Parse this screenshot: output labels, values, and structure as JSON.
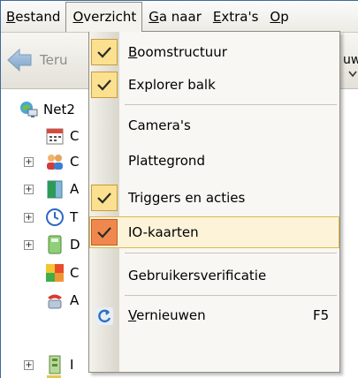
{
  "menubar": {
    "items": [
      {
        "label": "Bestand",
        "mnemonic": "B",
        "rest": "estand"
      },
      {
        "label": "Overzicht",
        "mnemonic": "O",
        "rest": "verzicht"
      },
      {
        "label": "Ga naar",
        "mnemonic": "G",
        "rest": "a naar"
      },
      {
        "label": "Extra's",
        "mnemonic": "E",
        "rest": "xtra's"
      },
      {
        "label": "Op",
        "mnemonic": "O",
        "rest": "p"
      }
    ]
  },
  "toolbar": {
    "back_label": "Teru",
    "right_label": "uw"
  },
  "tree": {
    "root_label": "Net2",
    "rows": [
      {
        "label": "C",
        "icon": "calendar-icon",
        "expander": false
      },
      {
        "label": "C",
        "icon": "users-icon",
        "expander": true
      },
      {
        "label": "A",
        "icon": "door-icon",
        "expander": true
      },
      {
        "label": "T",
        "icon": "clock-icon",
        "expander": true
      },
      {
        "label": "D",
        "icon": "device-icon",
        "expander": true
      },
      {
        "label": "C",
        "icon": "floorplan-icon",
        "expander": false
      },
      {
        "label": "A",
        "icon": "alarm-phone-icon",
        "expander": false
      },
      {
        "label": "I",
        "icon": "io-card-icon",
        "expander": true
      }
    ]
  },
  "menu": {
    "items": [
      {
        "label": "Boomstructuur",
        "mnemonic": "B",
        "rest": "oomstructuur",
        "checked": true
      },
      {
        "label": "Explorer balk",
        "mnemonic": "",
        "rest": "Explorer balk",
        "checked": true
      },
      {
        "label": "Camera's",
        "mnemonic": "",
        "rest": "Camera's",
        "checked": false
      },
      {
        "label": "Plattegrond",
        "mnemonic": "",
        "rest": "Plattegrond",
        "checked": false
      },
      {
        "label": "Triggers en acties",
        "mnemonic": "",
        "rest": "Triggers en acties",
        "checked": true
      },
      {
        "label": "IO-kaarten",
        "mnemonic": "",
        "rest": "IO-kaarten",
        "checked": true,
        "highlighted": true
      },
      {
        "label": "Gebruikersverificatie",
        "mnemonic": "",
        "rest": "Gebruikersverificatie",
        "checked": false
      },
      {
        "label": "Vernieuwen",
        "mnemonic": "V",
        "rest": "ernieuwen",
        "shortcut": "F5",
        "icon": "refresh-icon"
      }
    ]
  },
  "colors": {
    "check_bg": "#fbe08f",
    "check_active_bg": "#f0884d",
    "highlight_bg": "#fdf3d8",
    "highlight_border": "#e0b74f"
  }
}
